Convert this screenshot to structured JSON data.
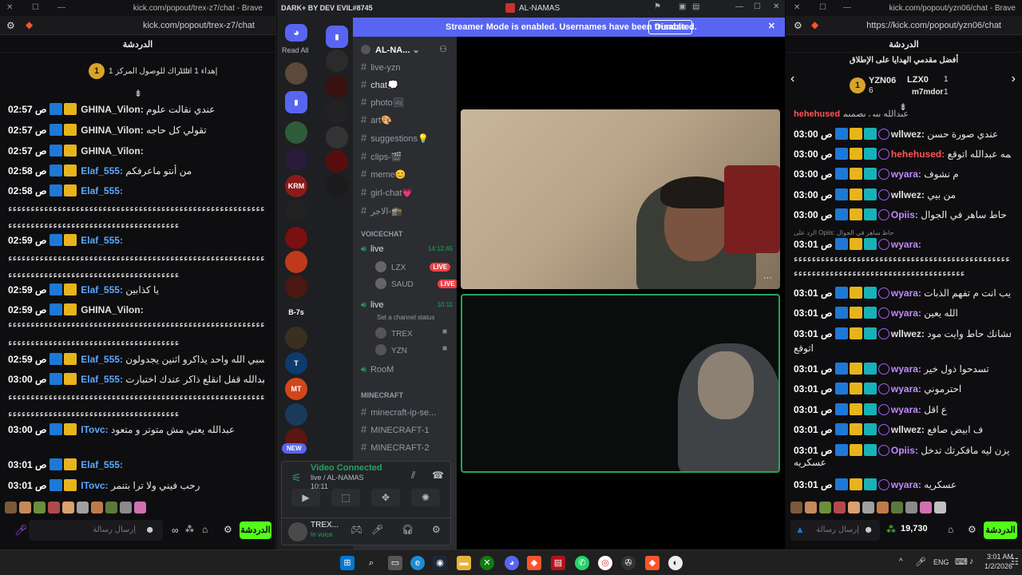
{
  "left": {
    "window_title": "kick.com/popout/trex-z7/chat - Brave",
    "address": "kick.com/popout/trex-z7/chat",
    "chat_header": "الدردشة",
    "pinned_text": "إهداء 1 اشتراك للوصول المركز 1",
    "pinned_tag": "1th",
    "coin": "1",
    "messages": [
      {
        "time": "02:57 ص",
        "user": "GHINA_Vilon:",
        "text": "عندي نقالت علوم",
        "color": "#e0e0e0"
      },
      {
        "time": "02:57 ص",
        "user": "GHINA_Vilon:",
        "text": "تقولي كل حاجه",
        "color": "#e0e0e0"
      },
      {
        "time": "02:57 ص",
        "user": "GHINA_Vilon:",
        "text": "",
        "color": "#e0e0e0"
      },
      {
        "time": "02:58 ص",
        "user": "Elaf_555:",
        "text": "من أنتو ماعرفكم",
        "color": "#5aa8ff"
      },
      {
        "time": "02:58 ص",
        "user": "Elaf_555:",
        "text": "",
        "color": "#5aa8ff"
      },
      {
        "time": "02:59 ص",
        "user": "Elaf_555:",
        "text": "",
        "color": "#5aa8ff"
      },
      {
        "time": "02:59 ص",
        "user": "Elaf_555:",
        "text": "يا كذابين",
        "color": "#5aa8ff"
      },
      {
        "time": "02:59 ص",
        "user": "GHINA_Vilon:",
        "text": "",
        "color": "#e0e0e0"
      },
      {
        "time": "02:59 ص",
        "user": "Elaf_555:",
        "text": "حسبي الله واحد يذاكرو اثنين يجدولون",
        "color": "#5aa8ff"
      },
      {
        "time": "03:00 ص",
        "user": "Elaf_555:",
        "text": "عبدالله قفل انقلع ذاكر عندك اختبارت",
        "color": "#5aa8ff"
      },
      {
        "time": "03:00 ص",
        "user": "ITovc:",
        "text": "عبدالله يعني مش متوتر و متعود",
        "color": "#5aa8ff"
      },
      {
        "time": "03:01 ص",
        "user": "Elaf_555:",
        "text": "",
        "color": "#5aa8ff"
      },
      {
        "time": "03:01 ص",
        "user": "ITovc:",
        "text": "رحب فيني ولا ترا بتنمر",
        "color": "#5aa8ff"
      }
    ],
    "spam_line": "ءءءءءءءءءءءءءءءءءءءءءءءءءءءءءءءءءءءءءءءءءءءءءءءءءءءءءءءءءءءءءءءءء",
    "spam_short": "ءءءءءءءءءءءءءءءءءءءءءءءءءءءءءءءءءءءءءء",
    "input_placeholder": "إرسال رسالة",
    "chat_button": "الدردشة"
  },
  "discord": {
    "client_title": "DARK+ BY DEV EVIL#8745",
    "window_title": "AL-NAMAS",
    "banner_text": "Streamer Mode is enabled. Usernames have been truncated.",
    "banner_button": "Disable",
    "read_all": "Read All",
    "new_badge": "NEW",
    "guild_labels": {
      "krm": "KRM",
      "b7s": "B-7s",
      "t": "T",
      "mt": "MT"
    },
    "server_name": "AL-NA...",
    "channels": [
      "live-yzn",
      "chat💭",
      "photo🖼",
      "art🎨",
      "suggestions💡",
      "clips-🎬",
      "meme😊",
      "girl-chat💗",
      "الاجر-🕋"
    ],
    "voice_category": "VOICECHAT",
    "voice_channels": [
      {
        "name": "live",
        "time": "14:12:45"
      },
      {
        "name": "live",
        "time": "10:11",
        "status": "Set a channel status"
      },
      {
        "name": "RooM"
      }
    ],
    "voice_users_1": [
      {
        "name": "LZX",
        "live": "LIVE"
      },
      {
        "name": "SAUD",
        "live": "LIVE"
      }
    ],
    "voice_users_2": [
      {
        "name": "TREX"
      },
      {
        "name": "YZN"
      }
    ],
    "mc_category": "MINECRAFT",
    "mc_channels": [
      "minecraft-ip-se...",
      "MINECRAFT-1",
      "MINECRAFT-2"
    ],
    "vc_status": "Video Connected",
    "vc_channel": "live / AL-NAMAS",
    "vc_time": "10:11",
    "user_name": "TREX...",
    "user_status": "In voice",
    "more": "···"
  },
  "right": {
    "window_title": "kick.com/popout/yzn06/chat - Brave",
    "address": "https://kick.com/popout/yzn06/chat",
    "chat_header": "الدردشة",
    "top_gifters_title": "أفضل مقدمي الهدايا على الإطلاق",
    "gifters": [
      {
        "name": "YZN06",
        "count": "6",
        "rank": "1"
      },
      {
        "name": "LZX0",
        "count": "1"
      },
      {
        "name": "m7mdor",
        "count": "1"
      }
    ],
    "top_partial": "عبدالله بيي بصميم",
    "top_partial_user": "hehehused",
    "messages": [
      {
        "time": "03:00 ص",
        "user": "wllwez:",
        "text": "عندي صورة حسن",
        "color": "#e0e0e0"
      },
      {
        "time": "03:00 ص",
        "user": "hehehused:",
        "text": "اسمه عبدالله اتوقع",
        "color": "#ff5555"
      },
      {
        "time": "03:00 ص",
        "user": "wyara:",
        "text": "م نشوف",
        "color": "#c08cff"
      },
      {
        "time": "03:00 ص",
        "user": "wllwez:",
        "text": "من بيي",
        "color": "#e0e0e0"
      },
      {
        "time": "03:00 ص",
        "user": "Opiis:",
        "text": "حاط ساهر في الجوال",
        "color": "#c08cff"
      },
      {
        "time": "03:01 ص",
        "user": "wyara:",
        "text": "",
        "color": "#c08cff"
      },
      {
        "time": "03:01 ص",
        "user": "wyara:",
        "text": "شايب انت م تفهم الذبات",
        "color": "#c08cff"
      },
      {
        "time": "03:01 ص",
        "user": "wyara:",
        "text": "الله يعين",
        "color": "#c08cff"
      },
      {
        "time": "03:01 ص",
        "user": "wllwez:",
        "text": "يقصد عشانك حاط وايت مود",
        "color": "#e0e0e0"
      },
      {
        "time": "03:01 ص",
        "user": "wyara:",
        "text": "تسدحوا ذول خير",
        "color": "#c08cff"
      },
      {
        "time": "03:01 ص",
        "user": "wyara:",
        "text": "احترموني",
        "color": "#c08cff"
      },
      {
        "time": "03:01 ص",
        "user": "wyara:",
        "text": "ع اقل",
        "color": "#c08cff"
      },
      {
        "time": "03:01 ص",
        "user": "wllwez:",
        "text": "ف ابيض صافع",
        "color": "#e0e0e0"
      },
      {
        "time": "03:01 ص",
        "user": "Opiis:",
        "text": "يزن ليه مافكرتك تدخل",
        "color": "#c08cff"
      },
      {
        "time": "03:01 ص",
        "user": "wyara:",
        "text": "عسكريه",
        "color": "#c08cff"
      }
    ],
    "reply_hint": "الرد على Opiis: حاط ساهر في الجوال",
    "wrap_1": "اتوقع",
    "wrap_2": "عسكريه",
    "last_msg": "عسكريه",
    "last_text": "عسكريه",
    "final_msg": {
      "time": "03:01 ص",
      "user": "wyara:",
      "text": "عسكريه"
    },
    "points": "19,730",
    "input_placeholder": "إرسال رسالة",
    "chat_button": "الدردشة"
  },
  "taskbar": {
    "lang": "ENG",
    "time": "3:01 AM",
    "date": "1/2/2026"
  },
  "colors": {
    "kick_green": "#53fc18",
    "discord_blurple": "#5865f2",
    "live_red": "#ed4245"
  }
}
